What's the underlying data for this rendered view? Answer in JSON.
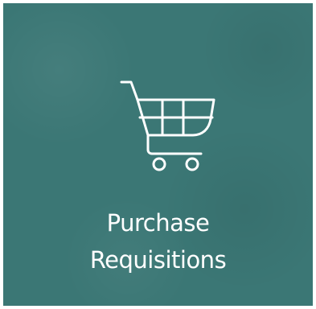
{
  "tile": {
    "title_line1": "Purchase",
    "title_line2": "Requisitions",
    "icon": "shopping-cart-icon",
    "background_color": "#3b7775",
    "foreground_color": "#ffffff"
  }
}
